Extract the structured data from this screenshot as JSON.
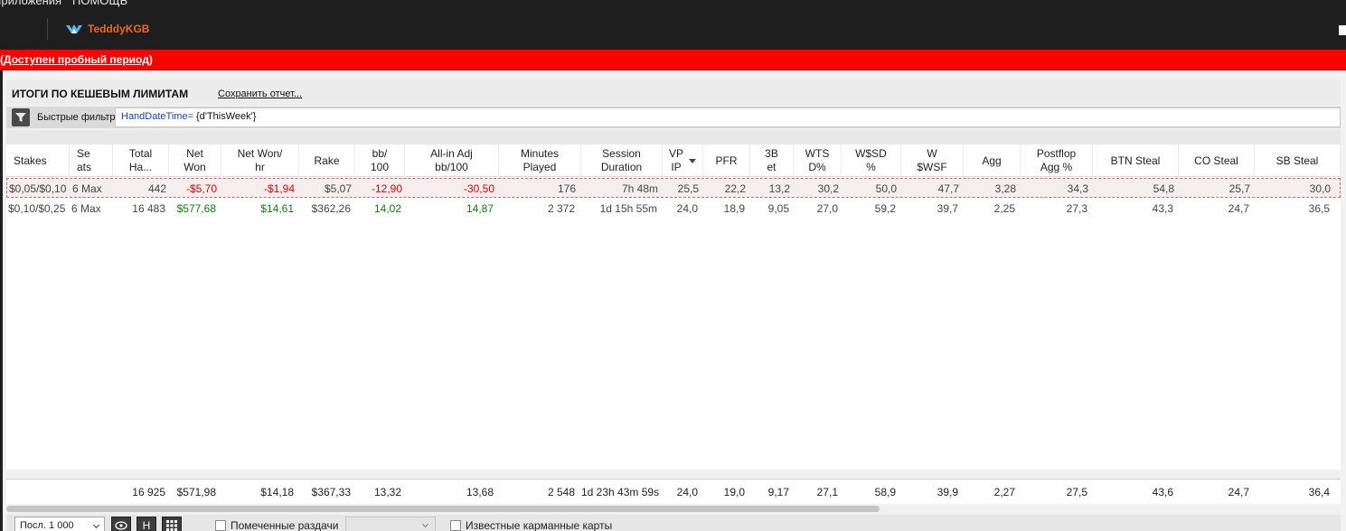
{
  "menu": {
    "items": [
      "Приложения",
      "ПОМОЩЬ"
    ]
  },
  "account": {
    "username": "TedddyKGB"
  },
  "trial": {
    "open_paren": "(",
    "link": "Доступен пробный период",
    "close_paren": ")"
  },
  "report": {
    "title": "ИТОГИ ПО КЕШЕВЫМ ЛИМИТАМ",
    "save_label": "Сохранить отчет..."
  },
  "filter": {
    "label": "Быстрые фильтры",
    "expr_key": "HandDateTime=",
    "expr_value": " {d'ThisWeek'}"
  },
  "table": {
    "columns": [
      "Stakes",
      "Se\nats",
      "Total\nHa...",
      "Net\nWon",
      "Net Won/\nhr",
      "Rake",
      "bb/\n100",
      "All-in Adj\nbb/100",
      "Minutes\nPlayed",
      "Session\nDuration",
      "VP\nIP",
      "PFR",
      "3B\net",
      "WTS\nD%",
      "W$SD\n%",
      "W\n$WSF",
      "Agg",
      "Postflop\nAgg %",
      "BTN Steal",
      "CO Steal",
      "SB Steal"
    ],
    "rows": [
      [
        "$0,05/$0,10",
        "6 Max",
        "442",
        "-$5,70",
        "-$1,94",
        "$5,07",
        "-12,90",
        "-30,50",
        "176",
        "7h 48m",
        "25,5",
        "22,2",
        "13,2",
        "30,2",
        "50,0",
        "47,7",
        "3,28",
        "34,3",
        "54,8",
        "25,7",
        "30,0"
      ],
      [
        "$0,10/$0,25",
        "6 Max",
        "16 483",
        "$577,68",
        "$14,61",
        "$362,26",
        "14,02",
        "14,87",
        "2 372",
        "1d 15h 55m",
        "24,0",
        "18,9",
        "9,05",
        "27,0",
        "59,2",
        "39,7",
        "2,25",
        "27,3",
        "43,3",
        "24,7",
        "36,5"
      ]
    ],
    "totals": [
      "",
      "",
      "16 925",
      "$571,98",
      "$14,18",
      "$367,33",
      "13,32",
      "13,68",
      "2 548",
      "1d 23h 43m 59s",
      "24,0",
      "19,0",
      "9,17",
      "27,1",
      "58,9",
      "39,9",
      "2,27",
      "27,5",
      "43,6",
      "24,7",
      "36,4"
    ]
  },
  "bottom": {
    "range_select": "Посл. 1 000",
    "h_button": "H",
    "marked_hands_label": "Помеченные раздачи",
    "known_cards_label": "Известные карманные карты"
  },
  "colors": {
    "trial_bar": "#ff0000",
    "username": "#f26522",
    "negative": "#e00000",
    "positive": "#137a13"
  }
}
